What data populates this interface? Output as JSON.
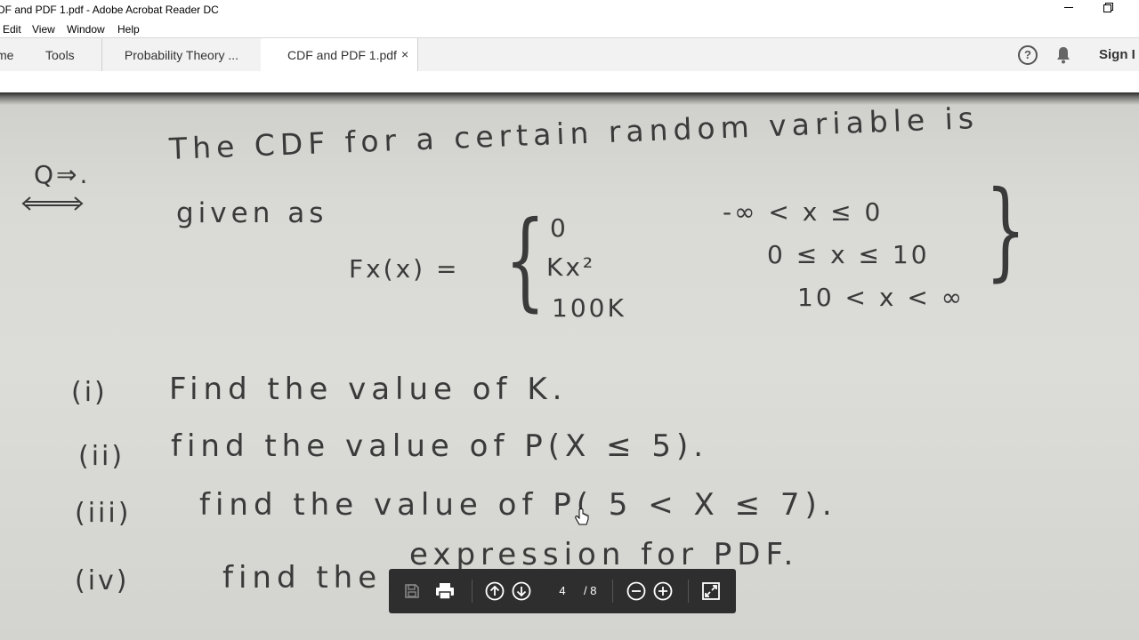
{
  "window": {
    "title": "DF and PDF 1.pdf - Adobe Acrobat Reader DC"
  },
  "menu": {
    "items": [
      "Edit",
      "View",
      "Window",
      "Help"
    ]
  },
  "tabs": {
    "home": "me",
    "tools": "Tools",
    "doc1": "Probability Theory ...",
    "doc2": "CDF and PDF 1.pdf",
    "close": "×"
  },
  "header": {
    "help_icon": "help-icon",
    "bell_icon": "bell-icon",
    "sign_in": "Sign I"
  },
  "document": {
    "q_label": "Q⇒.",
    "line1": "The CDF for a certain random variable is",
    "line2": "given as",
    "func": "Fx(x) =",
    "cases": [
      {
        "expr": "0",
        "cond": "-∞ < x ≤ 0"
      },
      {
        "expr": "Kx²",
        "cond": "0 ≤ x ≤ 10"
      },
      {
        "expr": "100K",
        "cond": "10 < x < ∞"
      }
    ],
    "questions": [
      {
        "num": "(i)",
        "text": "Find the value of K."
      },
      {
        "num": "(ii)",
        "text": "find the value of P(X ≤ 5)."
      },
      {
        "num": "(iii)",
        "text": "find the value of P( 5 < X ≤ 7)."
      },
      {
        "num": "(iv)",
        "text": "find the",
        "text2": "expression for PDF."
      }
    ]
  },
  "floating_toolbar": {
    "current_page": "4",
    "total_pages": "/ 8",
    "icons": [
      "save-icon",
      "print-icon",
      "arrow-up-icon",
      "arrow-down-icon",
      "zoom-out-icon",
      "zoom-in-icon",
      "fit-page-icon"
    ]
  }
}
